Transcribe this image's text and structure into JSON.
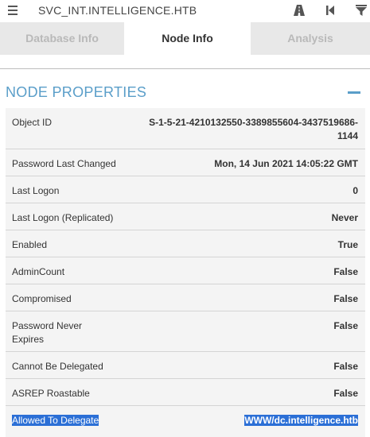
{
  "header": {
    "node_title": "SVC_INT.INTELLIGENCE.HTB",
    "icons": [
      "menu-icon",
      "pathfinding-icon",
      "back-icon",
      "filter-icon"
    ]
  },
  "tabs": [
    {
      "label": "Database Info",
      "active": false
    },
    {
      "label": "Node Info",
      "active": true
    },
    {
      "label": "Analysis",
      "active": false
    }
  ],
  "section": {
    "title": "NODE PROPERTIES",
    "collapse_icon": "minus-icon"
  },
  "properties": [
    {
      "label": "Object ID",
      "value": "S-1-5-21-4210132550-3389855604-3437519686-1144",
      "value_lines": [
        "S-1-5-21-4210132550-3389855604-3437519686-",
        "1144"
      ]
    },
    {
      "label": "Password Last Changed",
      "value": "Mon, 14 Jun 2021 14:05:22 GMT"
    },
    {
      "label": "Last Logon",
      "value": "0"
    },
    {
      "label": "Last Logon (Replicated)",
      "value": "Never"
    },
    {
      "label": "Enabled",
      "value": "True"
    },
    {
      "label": "AdminCount",
      "value": "False"
    },
    {
      "label": "Compromised",
      "value": "False"
    },
    {
      "label": "Password Never Expires",
      "label_lines": [
        "Password Never",
        "Expires"
      ],
      "value": "False"
    },
    {
      "label": "Cannot Be Delegated",
      "value": "False"
    },
    {
      "label": "ASREP Roastable",
      "value": "False"
    },
    {
      "label": "Allowed To Delegate",
      "value": "WWW/dc.intelligence.htb",
      "selected": true
    }
  ],
  "colors": {
    "accent": "#5a9ec9",
    "selection": "#2b6fd6",
    "tab_inactive_bg": "#e8e8e8",
    "row_bg": "#f4f4f4"
  }
}
